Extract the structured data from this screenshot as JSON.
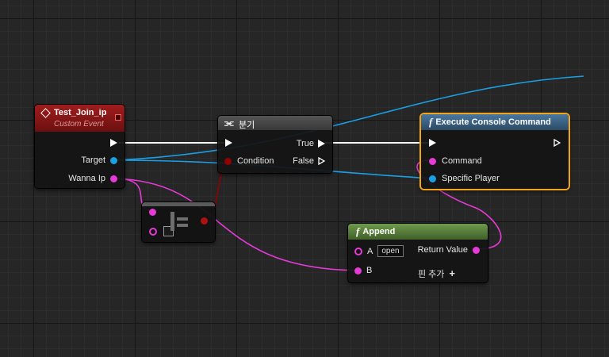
{
  "colors": {
    "exec": "#ffffff",
    "object": "#1b9fe4",
    "string": "#e53ad6",
    "bool": "#930000",
    "event_header": "#8a1616",
    "function_header": "#3a5f7e",
    "pure_header": "#5a7d3e",
    "branch_header": "#444444",
    "selected": "#f2a517"
  },
  "event_node": {
    "icon": "event-diamond-icon",
    "title": "Test_Join_ip",
    "subtitle": "Custom Event",
    "pins": {
      "target": "Target",
      "wanna_ip": "Wanna Ip"
    }
  },
  "branch_node": {
    "icon": "branch-icon",
    "title": "분기",
    "pins": {
      "condition": "Condition",
      "true": "True",
      "false": "False"
    }
  },
  "console_node": {
    "icon": "function-icon",
    "title": "Execute Console Command",
    "pins": {
      "command": "Command",
      "specific_player": "Specific Player"
    }
  },
  "append_node": {
    "icon": "function-icon",
    "title": "Append",
    "pins": {
      "a": "A",
      "a_value": "open",
      "b": "B",
      "return_value": "Return Value",
      "add_pin": "핀 추가"
    }
  },
  "equal_node": {
    "icon": "string-compare-icon"
  }
}
